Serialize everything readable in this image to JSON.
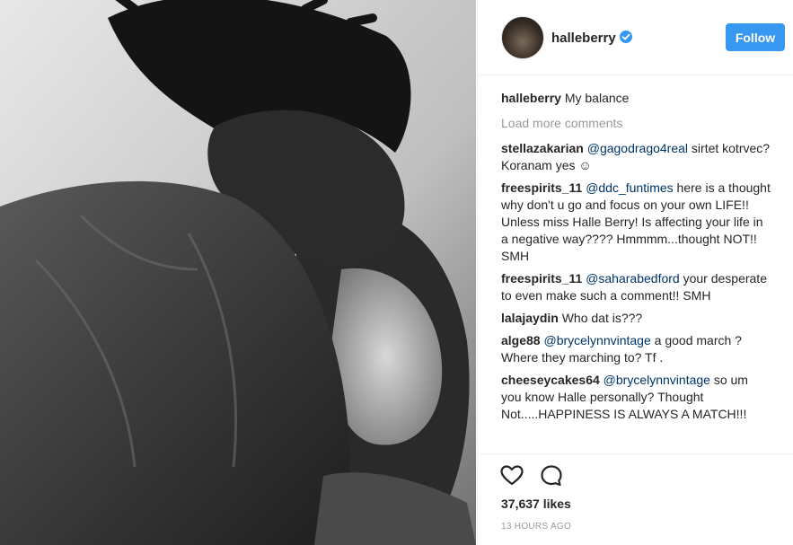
{
  "post": {
    "username": "halleberry",
    "follow_label": "Follow",
    "caption_user": "halleberry",
    "caption_text": "My balance",
    "load_more": "Load more comments",
    "comments": [
      {
        "user": "stellazakarian",
        "mention": "@gagodrago4real",
        "text": " sirtet kotrvec? Koranam yes ☺"
      },
      {
        "user": "freespirits_11",
        "mention": "@ddc_funtimes",
        "text": " here is a thought why don't u go and focus on your own LIFE!! Unless miss Halle Berry! Is affecting your life in a negative way???? Hmmmm...thought NOT!! SMH"
      },
      {
        "user": "freespirits_11",
        "mention": "@saharabedford",
        "text": " your desperate to even make such a comment!! SMH"
      },
      {
        "user": "lalajaydin",
        "mention": "",
        "text": "Who dat is???"
      },
      {
        "user": "alge88",
        "mention": "@brycelynnvintage",
        "text": " a good march ? Where they marching to? Tf ."
      },
      {
        "user": "cheeseycakes64",
        "mention": "@brycelynnvintage",
        "text": " so um you know Halle personally? Thought Not.....HAPPINESS IS ALWAYS A MATCH!!!"
      }
    ],
    "likes": "37,637 likes",
    "timestamp": "13 HOURS AGO"
  },
  "icons": {
    "verified": "verified-badge-icon",
    "like": "heart-icon",
    "comment": "comment-bubble-icon"
  },
  "colors": {
    "accent": "#3897f0",
    "mention": "#003569",
    "muted": "#999999",
    "text": "#262626"
  }
}
